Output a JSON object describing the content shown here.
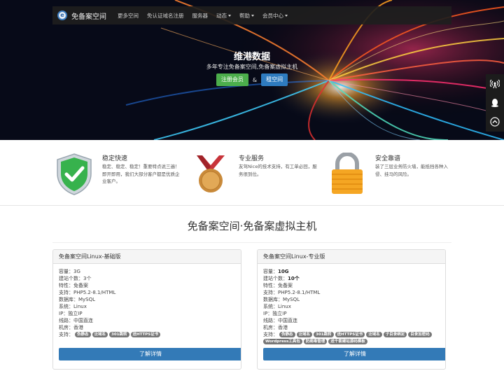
{
  "nav": {
    "brand": "免备案空间",
    "items": [
      {
        "label": "更多空间",
        "caret": false
      },
      {
        "label": "免认证域名注册",
        "caret": false
      },
      {
        "label": "服务器",
        "caret": false
      },
      {
        "label": "动态",
        "caret": true
      },
      {
        "label": "帮助",
        "caret": true
      },
      {
        "label": "会员中心",
        "caret": true
      }
    ]
  },
  "hero": {
    "title": "维港数据",
    "subtitle": "多年专注免备案空间,免备案虚拟主机",
    "register_label": "注册会员",
    "amp": "&",
    "rent_label": "租空间"
  },
  "features": [
    {
      "title": "稳定快速",
      "desc": "稳定、稳定、稳定！重要特点说三遍！即开即用，我们大部分客户都是优质企业客户。",
      "icon": "shield-check-icon"
    },
    {
      "title": "专业服务",
      "desc": "友驾Nice的技术支持，有工单必回，服务很到位。",
      "icon": "medal-icon"
    },
    {
      "title": "安全靠谱",
      "desc": "装了三层业务防火墙，能抵挡各种入侵、挂马的风险。",
      "icon": "padlock-icon"
    }
  ],
  "section_title": "免备案空间·免备案虚拟主机",
  "plans": [
    {
      "name": "免备案空间Linux-基础版",
      "specs": [
        {
          "label": "容量：",
          "value": "3G",
          "bold": false
        },
        {
          "label": "建站个数：",
          "value": "3个",
          "bold": false
        },
        {
          "label": "特性：",
          "value": "免备案",
          "bold": false
        },
        {
          "label": "支持：",
          "value": "PHP5.2-8.1/HTML",
          "bold": false
        },
        {
          "label": "数据库：",
          "value": "MySQL",
          "bold": false
        },
        {
          "label": "系统：",
          "value": "Linux",
          "bold": false
        },
        {
          "label": "IP：",
          "value": "独立IP",
          "bold": false
        },
        {
          "label": "线路：",
          "value": "中国直连",
          "bold": false
        },
        {
          "label": "机房：",
          "value": "香港",
          "bold": false
        }
      ],
      "support_label": "支持：",
      "tags": [
        "伪静态",
        "泛域名",
        "301跳转",
        "送HTTPS证书"
      ],
      "button": "了解详情"
    },
    {
      "name": "免备案空间Linux-专业版",
      "specs": [
        {
          "label": "容量：",
          "value": "10G",
          "bold": true
        },
        {
          "label": "建站个数：",
          "value": "10个",
          "bold": true
        },
        {
          "label": "特性：",
          "value": "免备案",
          "bold": false
        },
        {
          "label": "支持：",
          "value": "PHP5.2-8.1/HTML",
          "bold": false
        },
        {
          "label": "数据库：",
          "value": "MySQL",
          "bold": false
        },
        {
          "label": "系统：",
          "value": "Linux",
          "bold": false
        },
        {
          "label": "IP：",
          "value": "独立IP",
          "bold": false
        },
        {
          "label": "线路：",
          "value": "中国直连",
          "bold": false
        },
        {
          "label": "机房：",
          "value": "香港",
          "bold": false
        }
      ],
      "support_label": "支持：",
      "tags": [
        "伪静态",
        "泛域名",
        "301跳转",
        "送HTTPS证书",
        "泛域名",
        "子目录绑定",
        "目录加密码",
        "Wordpress工具包",
        "防病毒管理",
        "送千套建站源码模板"
      ],
      "button": "了解详情"
    }
  ],
  "side_tools": [
    "broadcast-icon",
    "qq-icon",
    "back-to-top-icon"
  ],
  "colors": {
    "nav_bg": "#1e1e1e",
    "green": "#4cae4c",
    "blue": "#337ab7",
    "tag_gray": "#777777"
  }
}
